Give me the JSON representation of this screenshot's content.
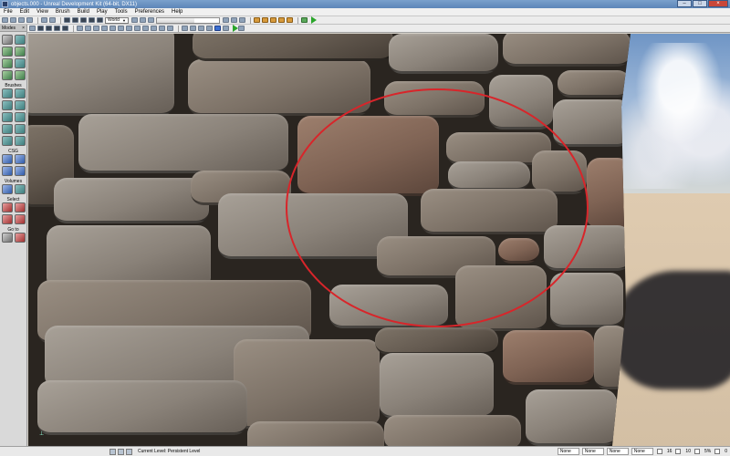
{
  "window": {
    "title": "objects.000 - Unreal Development Kit (64-bit, DX11)"
  },
  "menu": {
    "items": [
      "File",
      "Edit",
      "View",
      "Brush",
      "Build",
      "Play",
      "Tools",
      "Preferences",
      "Help"
    ]
  },
  "toolbar": {
    "coord_system": "World"
  },
  "modes": {
    "header": "Modes",
    "sections": {
      "brushes": "Brushes",
      "csg": "CSG",
      "volumes": "Volumes",
      "select": "Select",
      "goto": "Go to"
    }
  },
  "status": {
    "current_level": "Current Level:  Persistent Level",
    "fields": [
      "None",
      "None",
      "None",
      "None"
    ],
    "grid_value": "16",
    "rotation_value": "10",
    "scale_value": "5%",
    "extra_value": "0"
  },
  "colors": {
    "highlight_circle": "#d8252a",
    "title_bar": "#6b92c2",
    "play_icon": "#2aa52a"
  }
}
